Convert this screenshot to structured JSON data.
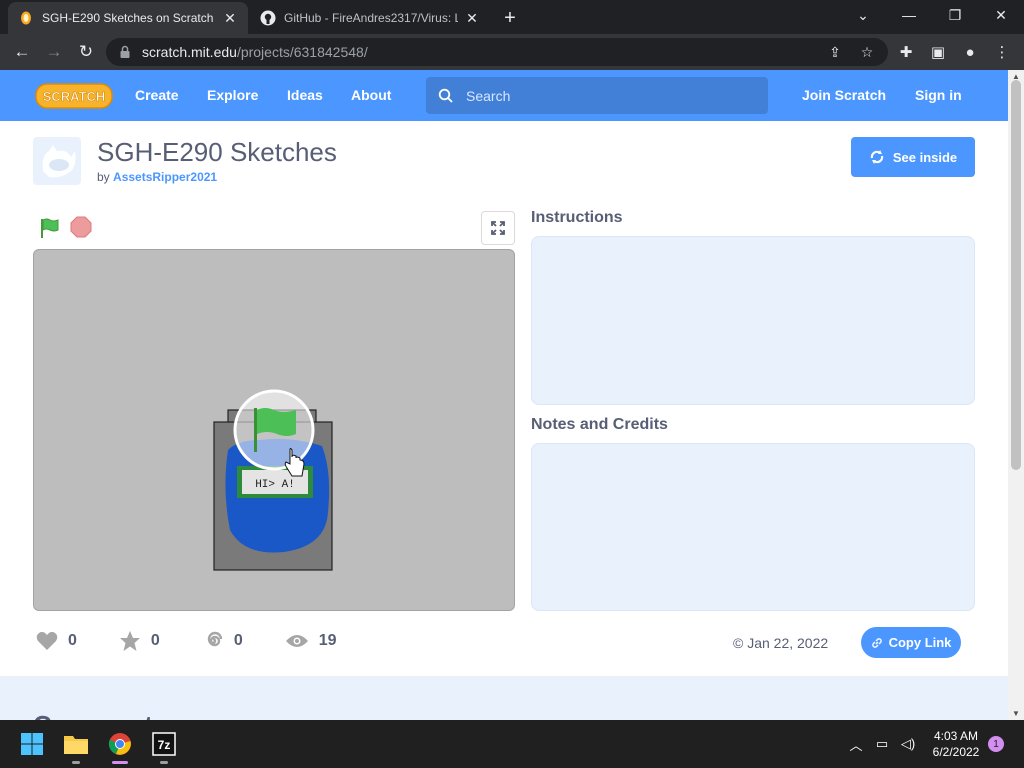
{
  "browser": {
    "tabs": [
      {
        "title": "SGH-E290 Sketches on Scratch",
        "active": true
      },
      {
        "title": "GitHub - FireAndres2317/Virus: L",
        "active": false
      }
    ],
    "url_host": "scratch.mit.edu",
    "url_path": "/projects/631842548/"
  },
  "scratch_nav": {
    "logo_text": "SCRATCH",
    "links": [
      "Create",
      "Explore",
      "Ideas",
      "About"
    ],
    "search_placeholder": "Search",
    "join": "Join Scratch",
    "sign_in": "Sign in"
  },
  "project": {
    "title": "SGH-E290 Sketches",
    "by_prefix": "by",
    "author": "AssetsRipper2021",
    "see_inside": "See inside",
    "stage_sprite_text": "HI> A!",
    "instructions_title": "Instructions",
    "notes_title": "Notes and Credits",
    "stats": {
      "loves": "0",
      "favorites": "0",
      "remixes": "0",
      "views": "19"
    },
    "date": "© Jan 22, 2022",
    "copy_link": "Copy Link",
    "comments_title": "Comments"
  },
  "taskbar": {
    "time": "4:03 AM",
    "date": "6/2/2022",
    "notifications": "1",
    "apps": [
      "start",
      "file-explorer",
      "chrome",
      "7zip"
    ],
    "app_7zip_label": "7z"
  },
  "colors": {
    "scratch_blue": "#4c97ff",
    "text": "#575e75",
    "panel": "#e9f1fc",
    "flag_green": "#4cbf56",
    "stop_red": "#ec9c9c"
  }
}
